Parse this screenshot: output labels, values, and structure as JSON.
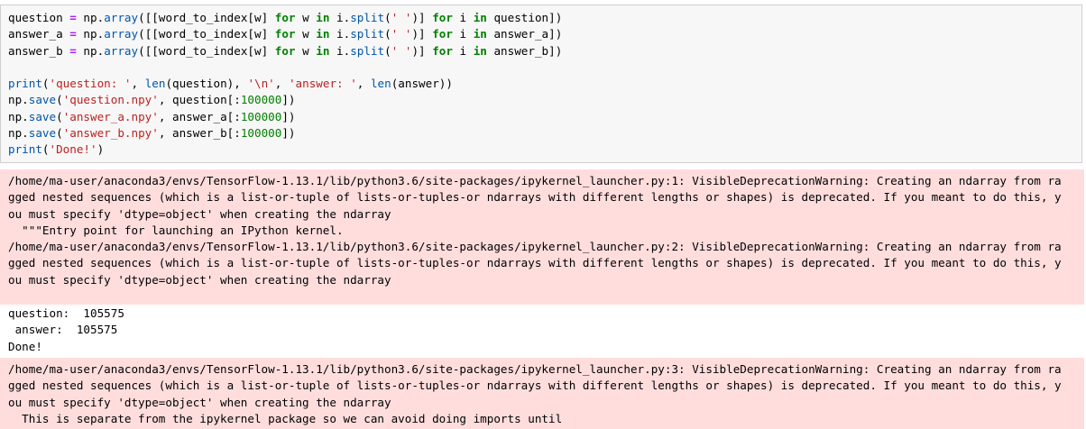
{
  "code_cell": {
    "lines": [
      "question = np.array([[word_to_index[w] for w in i.split(' ')] for i in question])",
      "answer_a = np.array([[word_to_index[w] for w in i.split(' ')] for i in answer_a])",
      "answer_b = np.array([[word_to_index[w] for w in i.split(' ')] for i in answer_b])",
      "",
      "print('question: ', len(question), '\\n', 'answer: ', len(answer))",
      "np.save('question.npy', question[:100000])",
      "np.save('answer_a.npy', answer_a[:100000])",
      "np.save('answer_b.npy', answer_b[:100000])",
      "print('Done!')"
    ]
  },
  "stderr_1": {
    "lines": [
      "/home/ma-user/anaconda3/envs/TensorFlow-1.13.1/lib/python3.6/site-packages/ipykernel_launcher.py:1: VisibleDeprecationWarning: Creating an ndarray from ra",
      "gged nested sequences (which is a list-or-tuple of lists-or-tuples-or ndarrays with different lengths or shapes) is deprecated. If you meant to do this, y",
      "ou must specify 'dtype=object' when creating the ndarray",
      "  \"\"\"Entry point for launching an IPython kernel.",
      "/home/ma-user/anaconda3/envs/TensorFlow-1.13.1/lib/python3.6/site-packages/ipykernel_launcher.py:2: VisibleDeprecationWarning: Creating an ndarray from ra",
      "gged nested sequences (which is a list-or-tuple of lists-or-tuples-or ndarrays with different lengths or shapes) is deprecated. If you meant to do this, y",
      "ou must specify 'dtype=object' when creating the ndarray"
    ]
  },
  "stdout": {
    "lines": [
      "question:  105575",
      " answer:  105575",
      "Done!"
    ]
  },
  "stderr_2": {
    "lines": [
      "/home/ma-user/anaconda3/envs/TensorFlow-1.13.1/lib/python3.6/site-packages/ipykernel_launcher.py:3: VisibleDeprecationWarning: Creating an ndarray from ra",
      "gged nested sequences (which is a list-or-tuple of lists-or-tuples-or ndarrays with different lengths or shapes) is deprecated. If you meant to do this, y",
      "ou must specify 'dtype=object' when creating the ndarray",
      "  This is separate from the ipykernel package so we can avoid doing imports until"
    ]
  },
  "colors": {
    "code_background": "#f7f7f7",
    "stderr_background": "#ffdddd",
    "keyword": "#008000",
    "string": "#ba2121"
  }
}
